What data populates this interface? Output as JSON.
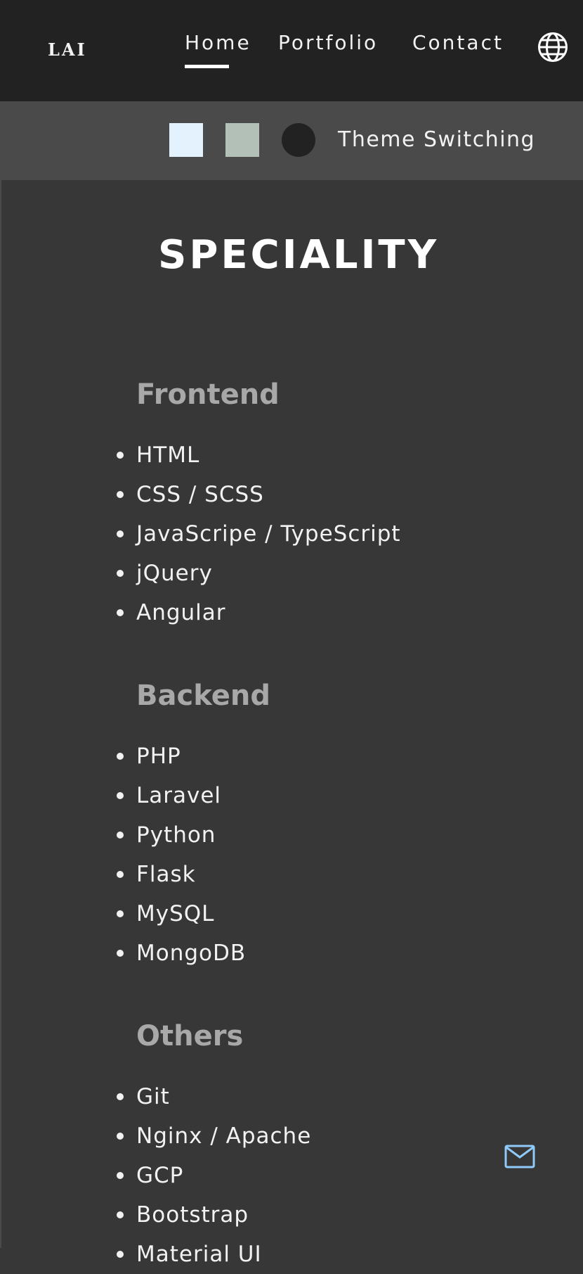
{
  "header": {
    "logo": "LAI",
    "nav": [
      {
        "label": "Home",
        "active": true
      },
      {
        "label": "Portfolio",
        "active": false
      },
      {
        "label": "Contact",
        "active": false
      }
    ],
    "language_icon": "globe-icon"
  },
  "theme_bar": {
    "swatches": [
      {
        "name": "light",
        "color": "#e3f2fd",
        "shape": "square"
      },
      {
        "name": "sage",
        "color": "#b2c0b8",
        "shape": "square"
      },
      {
        "name": "dark",
        "color": "#222222",
        "shape": "circle"
      }
    ],
    "label": "Theme Switching"
  },
  "speciality": {
    "title": "SPECIALITY",
    "groups": [
      {
        "title": "Frontend",
        "items": [
          "HTML",
          "CSS / SCSS",
          "JavaScripe / TypeScript",
          "jQuery",
          "Angular"
        ]
      },
      {
        "title": "Backend",
        "items": [
          "PHP",
          "Laravel",
          "Python",
          "Flask",
          "MySQL",
          "MongoDB"
        ]
      },
      {
        "title": "Others",
        "items": [
          "Git",
          "Nginx / Apache",
          "GCP",
          "Bootstrap",
          "Material UI"
        ]
      }
    ]
  },
  "mail_icon": "mail-icon",
  "colors": {
    "nav_bg": "#222222",
    "theme_bar_bg": "#4a4a4a",
    "page_bg": "#373737",
    "group_title": "#a8a8a8",
    "mail_accent": "#90caf9"
  }
}
